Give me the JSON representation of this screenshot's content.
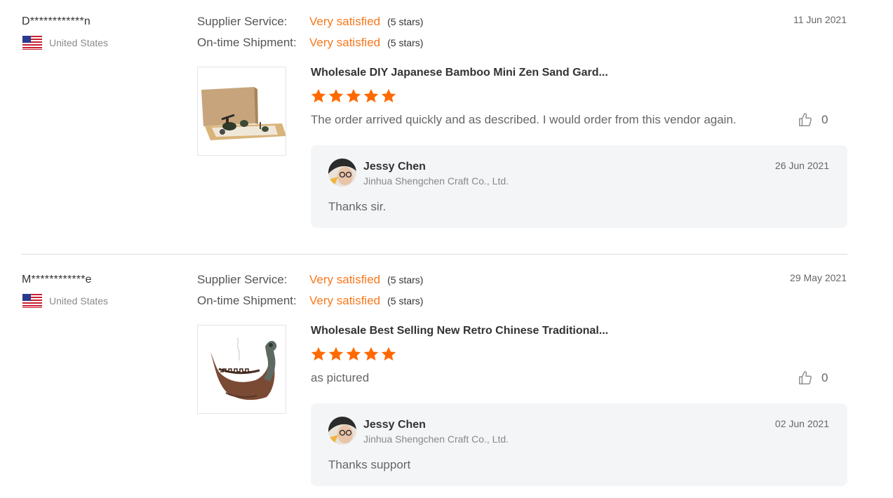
{
  "reviews": [
    {
      "reviewer": "D************n",
      "country": "United States",
      "supplier_service_label": "Supplier Service:",
      "supplier_service_value": "Very satisfied",
      "supplier_service_stars": "(5 stars)",
      "shipment_label": "On-time Shipment:",
      "shipment_value": "Very satisfied",
      "shipment_stars": "(5 stars)",
      "date": "11 Jun 2021",
      "product_title": "Wholesale DIY Japanese Bamboo Mini Zen Sand Gard...",
      "rating": 5,
      "text": "The order arrived quickly and as described.  I would order from this vendor again.",
      "likes": "0",
      "reply": {
        "name": "Jessy Chen",
        "company": "Jinhua Shengchen Craft Co., Ltd.",
        "date": "26 Jun 2021",
        "text": "Thanks sir."
      }
    },
    {
      "reviewer": "M************e",
      "country": "United States",
      "supplier_service_label": "Supplier Service:",
      "supplier_service_value": "Very satisfied",
      "supplier_service_stars": "(5 stars)",
      "shipment_label": "On-time Shipment:",
      "shipment_value": "Very satisfied",
      "shipment_stars": "(5 stars)",
      "date": "29 May 2021",
      "product_title": "Wholesale Best Selling New Retro Chinese Traditional...",
      "rating": 5,
      "text": "as pictured",
      "likes": "0",
      "reply": {
        "name": "Jessy Chen",
        "company": "Jinhua Shengchen Craft Co., Ltd.",
        "date": "02 Jun 2021",
        "text": "Thanks support"
      }
    }
  ],
  "colors": {
    "accent": "#f7781d",
    "star": "#ff6a00",
    "reply_bg": "#f4f5f7"
  },
  "icons": {
    "flag": "us-flag-icon",
    "like": "thumbs-up-icon",
    "star": "star-icon"
  }
}
